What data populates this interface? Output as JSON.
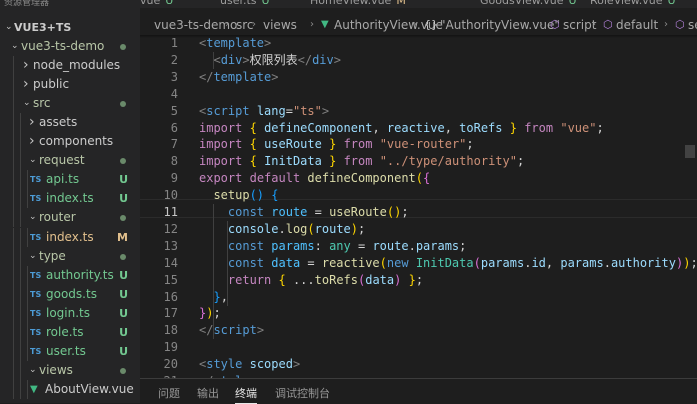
{
  "top": {
    "explorer_label": "资源管理器",
    "tabs": [
      {
        "name": "vue",
        "badge": "U",
        "badge_type": "untracked"
      },
      {
        "name": "user.ts",
        "badge": "U",
        "badge_type": "untracked"
      },
      {
        "name": "HomeView.vue",
        "badge": "M",
        "badge_type": "modified"
      },
      {
        "name": "GoodsView.vue",
        "badge": "U",
        "badge_type": "untracked"
      },
      {
        "name": "RoleView.vue",
        "badge": "U",
        "badge_type": "untracked"
      }
    ]
  },
  "sidebar": {
    "workspace": "VUE3+TS",
    "items": [
      {
        "label": "vue3-ts-demo",
        "kind": "folder-open",
        "depth": 1,
        "status": "dot"
      },
      {
        "label": "node_modules",
        "kind": "folder-closed",
        "depth": 2
      },
      {
        "label": "public",
        "kind": "folder-closed",
        "depth": 2
      },
      {
        "label": "src",
        "kind": "folder-open",
        "depth": 2,
        "status": "dot"
      },
      {
        "label": "assets",
        "kind": "folder-closed",
        "depth": 3
      },
      {
        "label": "components",
        "kind": "folder-closed",
        "depth": 3
      },
      {
        "label": "request",
        "kind": "folder-open",
        "depth": 3,
        "status": "dot"
      },
      {
        "label": "api.ts",
        "kind": "ts",
        "depth": 4,
        "badge": "U",
        "badge_type": "untracked"
      },
      {
        "label": "index.ts",
        "kind": "ts",
        "depth": 4,
        "badge": "U",
        "badge_type": "untracked"
      },
      {
        "label": "router",
        "kind": "folder-open",
        "depth": 3,
        "status": "dot"
      },
      {
        "label": "index.ts",
        "kind": "ts",
        "depth": 4,
        "badge": "M",
        "badge_type": "modified"
      },
      {
        "label": "type",
        "kind": "folder-open",
        "depth": 3,
        "status": "dot"
      },
      {
        "label": "authority.ts",
        "kind": "ts",
        "depth": 4,
        "badge": "U",
        "badge_type": "untracked"
      },
      {
        "label": "goods.ts",
        "kind": "ts",
        "depth": 4,
        "badge": "U",
        "badge_type": "untracked"
      },
      {
        "label": "login.ts",
        "kind": "ts",
        "depth": 4,
        "badge": "U",
        "badge_type": "untracked"
      },
      {
        "label": "role.ts",
        "kind": "ts",
        "depth": 4,
        "badge": "U",
        "badge_type": "untracked"
      },
      {
        "label": "user.ts",
        "kind": "ts",
        "depth": 4,
        "badge": "U",
        "badge_type": "untracked"
      },
      {
        "label": "views",
        "kind": "folder-open",
        "depth": 3,
        "status": "dot"
      },
      {
        "label": "AboutView.vue",
        "kind": "vue",
        "depth": 4
      }
    ]
  },
  "breadcrumb": {
    "parts": [
      "vue3-ts-demo",
      "src",
      "views",
      "AuthorityView.vue",
      "\"AuthorityView.vue\"",
      "script",
      "default",
      "setup"
    ],
    "icons": [
      "",
      "",
      "",
      "vue-icon",
      "braces-icon",
      "cube-icon",
      "cube-icon",
      "cube-icon"
    ]
  },
  "editor": {
    "active_line": 11,
    "lines": [
      {
        "n": "1",
        "tokens": [
          [
            "br",
            "<"
          ],
          [
            "tag",
            "template"
          ],
          [
            "br",
            ">"
          ]
        ]
      },
      {
        "n": "2",
        "tokens": [
          [
            "txt",
            "  "
          ],
          [
            "br",
            "<"
          ],
          [
            "tag",
            "div"
          ],
          [
            "br",
            ">"
          ],
          [
            "txt",
            "权限列表"
          ],
          [
            "br",
            "</"
          ],
          [
            "tag",
            "div"
          ],
          [
            "br",
            ">"
          ]
        ]
      },
      {
        "n": "3",
        "tokens": [
          [
            "br",
            "</"
          ],
          [
            "tag",
            "template"
          ],
          [
            "br",
            ">"
          ]
        ]
      },
      {
        "n": "4",
        "tokens": []
      },
      {
        "n": "5",
        "tokens": [
          [
            "br",
            "<"
          ],
          [
            "tag",
            "script"
          ],
          [
            "txt",
            " "
          ],
          [
            "attr",
            "lang"
          ],
          [
            "txt",
            "="
          ],
          [
            "str",
            "\"ts\""
          ],
          [
            "br",
            ">"
          ]
        ]
      },
      {
        "n": "6",
        "tokens": [
          [
            "kw",
            "import"
          ],
          [
            "txt",
            " "
          ],
          [
            "b1",
            "{"
          ],
          [
            "txt",
            " "
          ],
          [
            "var",
            "defineComponent"
          ],
          [
            "txt",
            ", "
          ],
          [
            "var",
            "reactive"
          ],
          [
            "txt",
            ", "
          ],
          [
            "var",
            "toRefs"
          ],
          [
            "txt",
            " "
          ],
          [
            "b1",
            "}"
          ],
          [
            "txt",
            " "
          ],
          [
            "kw",
            "from"
          ],
          [
            "txt",
            " "
          ],
          [
            "str",
            "\"vue\""
          ],
          [
            "txt",
            ";"
          ]
        ]
      },
      {
        "n": "7",
        "tokens": [
          [
            "kw",
            "import"
          ],
          [
            "txt",
            " "
          ],
          [
            "b1",
            "{"
          ],
          [
            "txt",
            " "
          ],
          [
            "var",
            "useRoute"
          ],
          [
            "txt",
            " "
          ],
          [
            "b1",
            "}"
          ],
          [
            "txt",
            " "
          ],
          [
            "kw",
            "from"
          ],
          [
            "txt",
            " "
          ],
          [
            "str",
            "\"vue-router\""
          ],
          [
            "txt",
            ";"
          ]
        ]
      },
      {
        "n": "8",
        "tokens": [
          [
            "kw",
            "import"
          ],
          [
            "txt",
            " "
          ],
          [
            "b1",
            "{"
          ],
          [
            "txt",
            " "
          ],
          [
            "var",
            "InitData"
          ],
          [
            "txt",
            " "
          ],
          [
            "b1",
            "}"
          ],
          [
            "txt",
            " "
          ],
          [
            "kw",
            "from"
          ],
          [
            "txt",
            " "
          ],
          [
            "str",
            "\"../type/authority\""
          ],
          [
            "txt",
            ";"
          ]
        ]
      },
      {
        "n": "9",
        "tokens": [
          [
            "kw",
            "export"
          ],
          [
            "txt",
            " "
          ],
          [
            "kw",
            "default"
          ],
          [
            "txt",
            " "
          ],
          [
            "fn",
            "defineComponent"
          ],
          [
            "b1",
            "("
          ],
          [
            "b2",
            "{"
          ]
        ]
      },
      {
        "n": "10",
        "tokens": [
          [
            "txt",
            "  "
          ],
          [
            "fn",
            "setup"
          ],
          [
            "b3",
            "()"
          ],
          [
            "txt",
            " "
          ],
          [
            "b3",
            "{"
          ]
        ]
      },
      {
        "n": "11",
        "tokens": [
          [
            "txt",
            "    "
          ],
          [
            "kwb",
            "const"
          ],
          [
            "txt",
            " "
          ],
          [
            "cn",
            "route"
          ],
          [
            "txt",
            " = "
          ],
          [
            "fn",
            "useRoute"
          ],
          [
            "b1",
            "()"
          ],
          [
            "txt",
            ";"
          ]
        ]
      },
      {
        "n": "12",
        "tokens": [
          [
            "txt",
            "    "
          ],
          [
            "var",
            "console"
          ],
          [
            "txt",
            "."
          ],
          [
            "fn",
            "log"
          ],
          [
            "b1",
            "("
          ],
          [
            "var",
            "route"
          ],
          [
            "b1",
            ")"
          ],
          [
            "txt",
            ";"
          ]
        ]
      },
      {
        "n": "13",
        "tokens": [
          [
            "txt",
            "    "
          ],
          [
            "kwb",
            "const"
          ],
          [
            "txt",
            " "
          ],
          [
            "cn",
            "params"
          ],
          [
            "txt",
            ": "
          ],
          [
            "cls",
            "any"
          ],
          [
            "txt",
            " = "
          ],
          [
            "var",
            "route"
          ],
          [
            "txt",
            "."
          ],
          [
            "var",
            "params"
          ],
          [
            "txt",
            ";"
          ]
        ]
      },
      {
        "n": "14",
        "tokens": [
          [
            "txt",
            "    "
          ],
          [
            "kwb",
            "const"
          ],
          [
            "txt",
            " "
          ],
          [
            "cn",
            "data"
          ],
          [
            "txt",
            " = "
          ],
          [
            "fn",
            "reactive"
          ],
          [
            "b1",
            "("
          ],
          [
            "kwb",
            "new"
          ],
          [
            "txt",
            " "
          ],
          [
            "cls",
            "InitData"
          ],
          [
            "b2",
            "("
          ],
          [
            "var",
            "params"
          ],
          [
            "txt",
            "."
          ],
          [
            "var",
            "id"
          ],
          [
            "txt",
            ", "
          ],
          [
            "var",
            "params"
          ],
          [
            "txt",
            "."
          ],
          [
            "var",
            "authority"
          ],
          [
            "b2",
            ")"
          ],
          [
            "b1",
            ")"
          ],
          [
            "txt",
            ";"
          ]
        ]
      },
      {
        "n": "15",
        "tokens": [
          [
            "txt",
            "    "
          ],
          [
            "kw",
            "return"
          ],
          [
            "txt",
            " "
          ],
          [
            "b1",
            "{"
          ],
          [
            "txt",
            " ..."
          ],
          [
            "fn",
            "toRefs"
          ],
          [
            "b2",
            "("
          ],
          [
            "var",
            "data"
          ],
          [
            "b2",
            ")"
          ],
          [
            "txt",
            " "
          ],
          [
            "b1",
            "}"
          ],
          [
            "txt",
            ";"
          ]
        ]
      },
      {
        "n": "16",
        "tokens": [
          [
            "txt",
            "  "
          ],
          [
            "b3",
            "}"
          ],
          [
            "txt",
            ","
          ]
        ]
      },
      {
        "n": "17",
        "tokens": [
          [
            "b2",
            "}"
          ],
          [
            "b1",
            ")"
          ],
          [
            "txt",
            ";"
          ]
        ]
      },
      {
        "n": "18",
        "tokens": [
          [
            "br",
            "</"
          ],
          [
            "tag",
            "script"
          ],
          [
            "br",
            ">"
          ]
        ]
      },
      {
        "n": "19",
        "tokens": []
      },
      {
        "n": "20",
        "tokens": [
          [
            "br",
            "<"
          ],
          [
            "tag",
            "style"
          ],
          [
            "txt",
            " "
          ],
          [
            "attr",
            "scoped"
          ],
          [
            "br",
            ">"
          ]
        ]
      },
      {
        "n": "21",
        "tokens": [
          [
            "br",
            "</"
          ],
          [
            "tag",
            "style"
          ],
          [
            "br",
            ">"
          ]
        ]
      }
    ]
  },
  "panel": {
    "tabs": [
      {
        "label": "问题",
        "active": false
      },
      {
        "label": "输出",
        "active": false
      },
      {
        "label": "终端",
        "active": true
      },
      {
        "label": "调试控制台",
        "active": false
      }
    ]
  }
}
